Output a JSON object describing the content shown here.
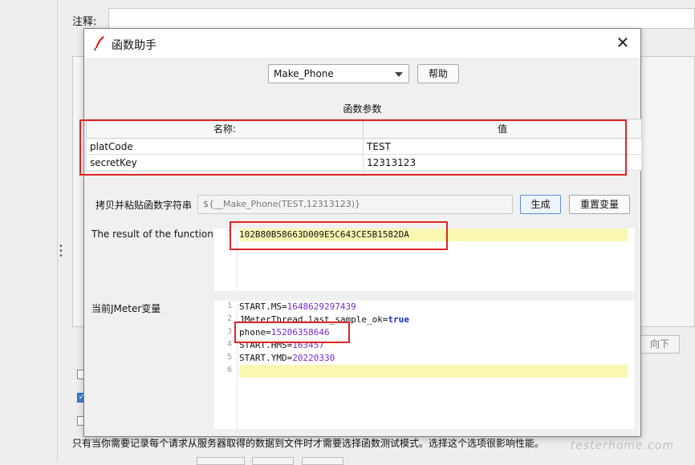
{
  "background": {
    "comment_label": "注释:",
    "down_button": "向下",
    "note": "只有当你需要记录每个请求从服务器取得的数据到文件时才需要选择函数测试模式。选择这个选项很影响性能。",
    "watermark": "testerhome.com"
  },
  "dialog": {
    "title": "函数助手",
    "function_select": {
      "selected": "Make_Phone"
    },
    "help_button": "帮助",
    "params_heading": "函数参数",
    "params_table": {
      "headers": [
        "名称:",
        "值"
      ],
      "rows": [
        {
          "name": "platCode",
          "value": "TEST"
        },
        {
          "name": "secretKey",
          "value": "12313123"
        }
      ]
    },
    "copy_label": "拷贝并粘贴函数字符串",
    "function_string": "${__Make_Phone(TEST,12313123)}",
    "generate_button": "生成",
    "reset_button": "重置变量",
    "result_label": "The result of the function is",
    "result_lines": [
      {
        "no": "1",
        "text": "102B80B58663D009E5C643CE5B1582DA"
      }
    ],
    "vars_label": "当前JMeter变量",
    "vars_lines": [
      {
        "no": "1",
        "key": "START.MS=",
        "value": "1648629297439"
      },
      {
        "no": "2",
        "key": "JMeterThread.last_sample_ok=",
        "value": "true"
      },
      {
        "no": "3",
        "key": "phone=",
        "value": "15206358646"
      },
      {
        "no": "4",
        "key": "START.HMS=",
        "value": "163457"
      },
      {
        "no": "5",
        "key": "START.YMD=",
        "value": "20220330"
      },
      {
        "no": "6",
        "key": "",
        "value": ""
      }
    ]
  },
  "colors": {
    "annotation_red": "#e02424",
    "highlight_line": "#fbf7b3",
    "number": "#7a2ad4",
    "keyword": "#1a2dbf"
  },
  "icons": {
    "app": "feather-icon",
    "close": "close-icon",
    "dropdown": "chevron-down-icon"
  }
}
